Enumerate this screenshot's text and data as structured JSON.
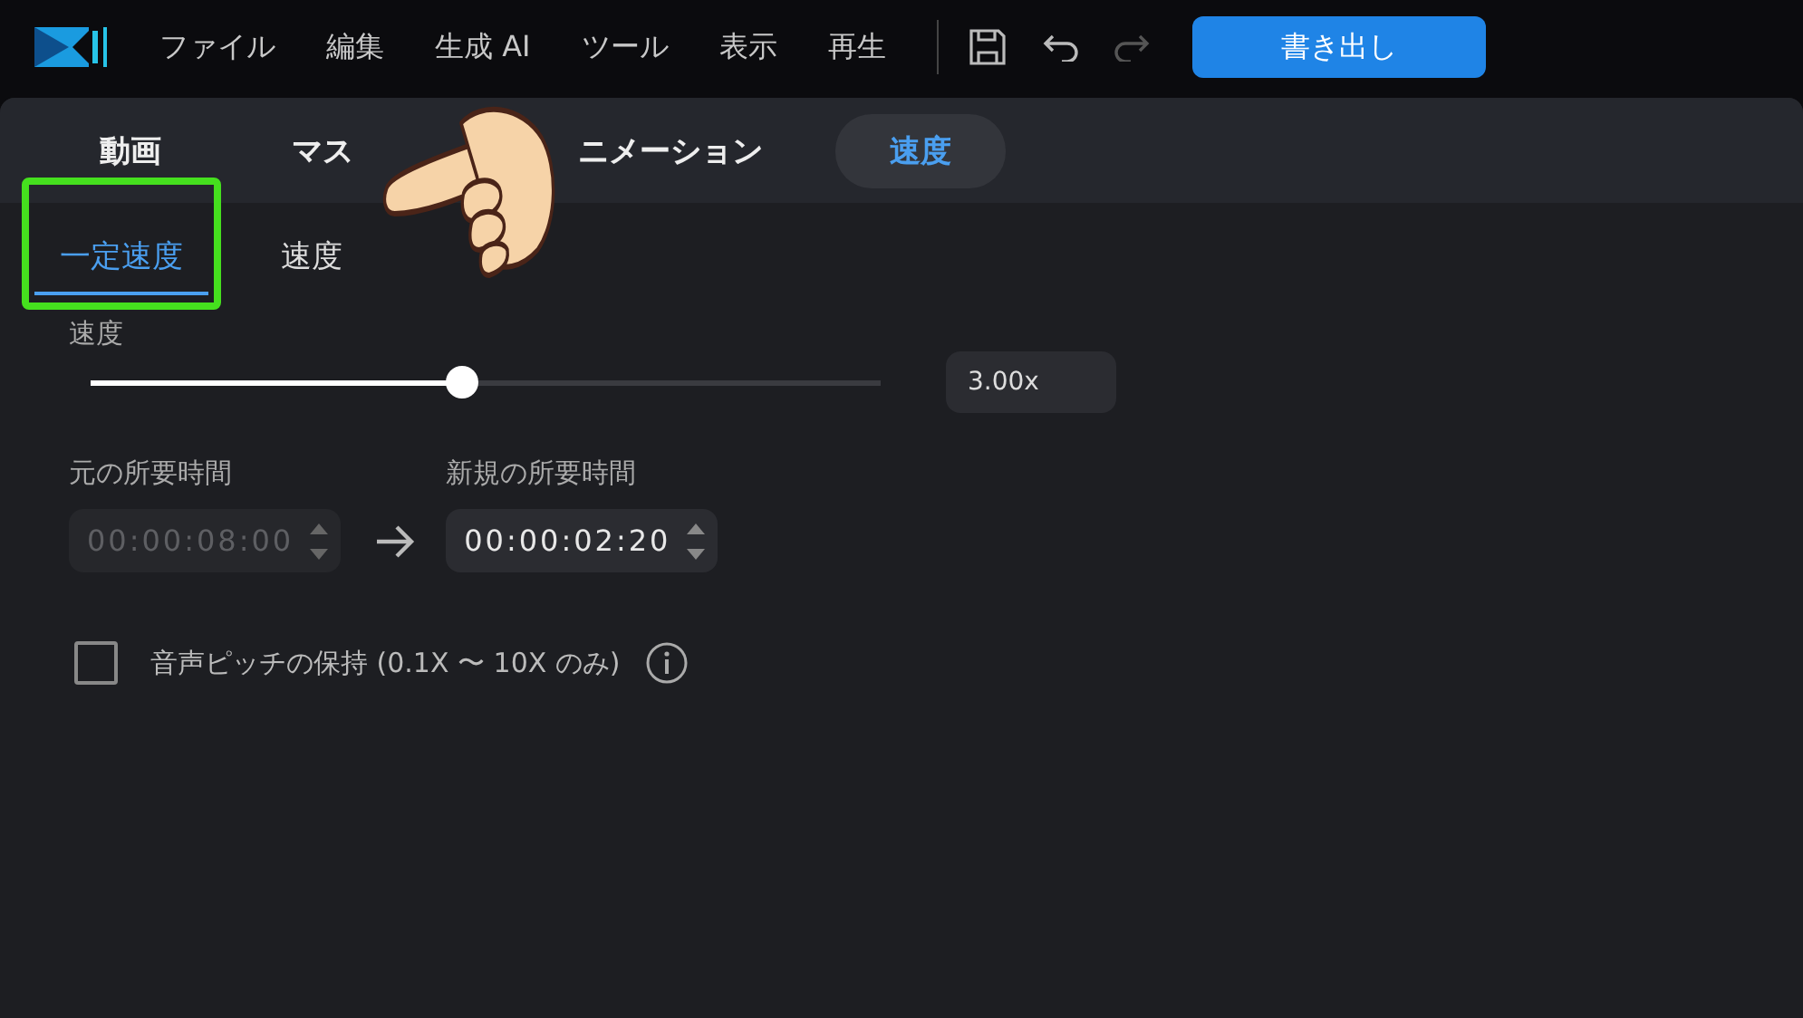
{
  "menu": [
    "ファイル",
    "編集",
    "生成 AI",
    "ツール",
    "表示",
    "再生"
  ],
  "export_button": "書き出し",
  "tabs": [
    {
      "label": "動画",
      "selected": false,
      "bold": true
    },
    {
      "label": "マス",
      "selected": false,
      "bold": true
    },
    {
      "label": "ニメーション",
      "selected": false,
      "bold": true
    },
    {
      "label": "速度",
      "selected": true,
      "bold": true
    }
  ],
  "sub_tabs": [
    {
      "label": "一定速度",
      "selected": true,
      "highlighted": true
    },
    {
      "label": "速度",
      "selected": false,
      "highlighted": false
    }
  ],
  "speed": {
    "label": "速度",
    "level": 0.47,
    "value": "3.00x"
  },
  "original_duration": {
    "label": "元の所要時間",
    "value": "00:00:08:00",
    "disabled": true
  },
  "new_duration": {
    "label": "新規の所要時間",
    "value": "00:00:02:20",
    "disabled": false
  },
  "pitch": {
    "label": "音声ピッチの保持 (0.1X 〜 10X のみ)",
    "checked": false
  },
  "overlay": {
    "kind": "pointing-hand"
  }
}
